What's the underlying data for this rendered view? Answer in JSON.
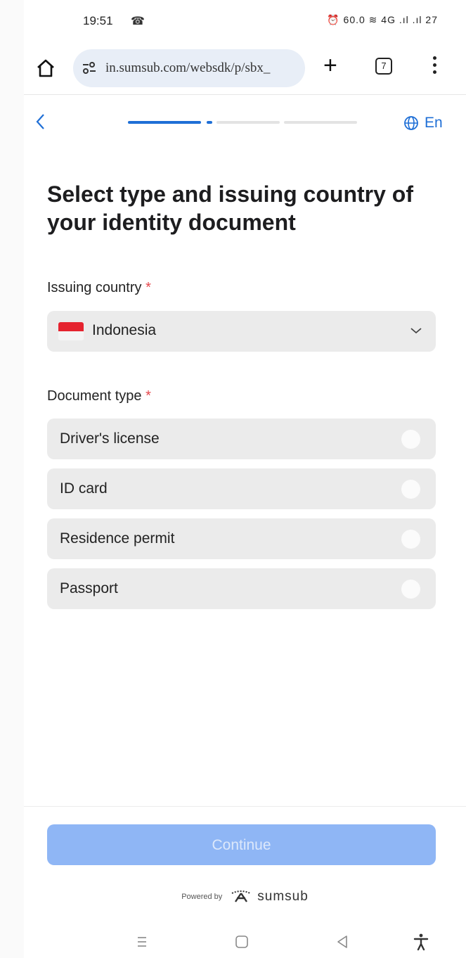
{
  "status_bar": {
    "time": "19:51",
    "indicators": "⏰ 60.0 ≋ 4G .ıl .ıl 27"
  },
  "browser": {
    "url": "in.sumsub.com/websdk/p/sbx_",
    "tab_count": "7",
    "icons": [
      "home-icon",
      "site-info-icon",
      "plus-icon",
      "tabs-icon",
      "more-vert-icon"
    ]
  },
  "header": {
    "language_label": "En",
    "progress_step": 2,
    "progress_total": 3
  },
  "page": {
    "title": "Select type and issuing country of your identity document",
    "country_field": {
      "label": "Issuing country",
      "required_mark": "*",
      "value": "Indonesia"
    },
    "document_field": {
      "label": "Document type",
      "required_mark": "*",
      "options": [
        {
          "label": "Driver's license"
        },
        {
          "label": "ID card"
        },
        {
          "label": "Residence permit"
        },
        {
          "label": "Passport"
        }
      ]
    }
  },
  "footer": {
    "continue_label": "Continue",
    "powered_by": "Powered by",
    "brand": "sumsub"
  },
  "colors": {
    "accent": "#1f6fd6",
    "button_disabled": "#8fb6f5",
    "required": "#e5484d",
    "field_bg": "#ebebeb"
  }
}
